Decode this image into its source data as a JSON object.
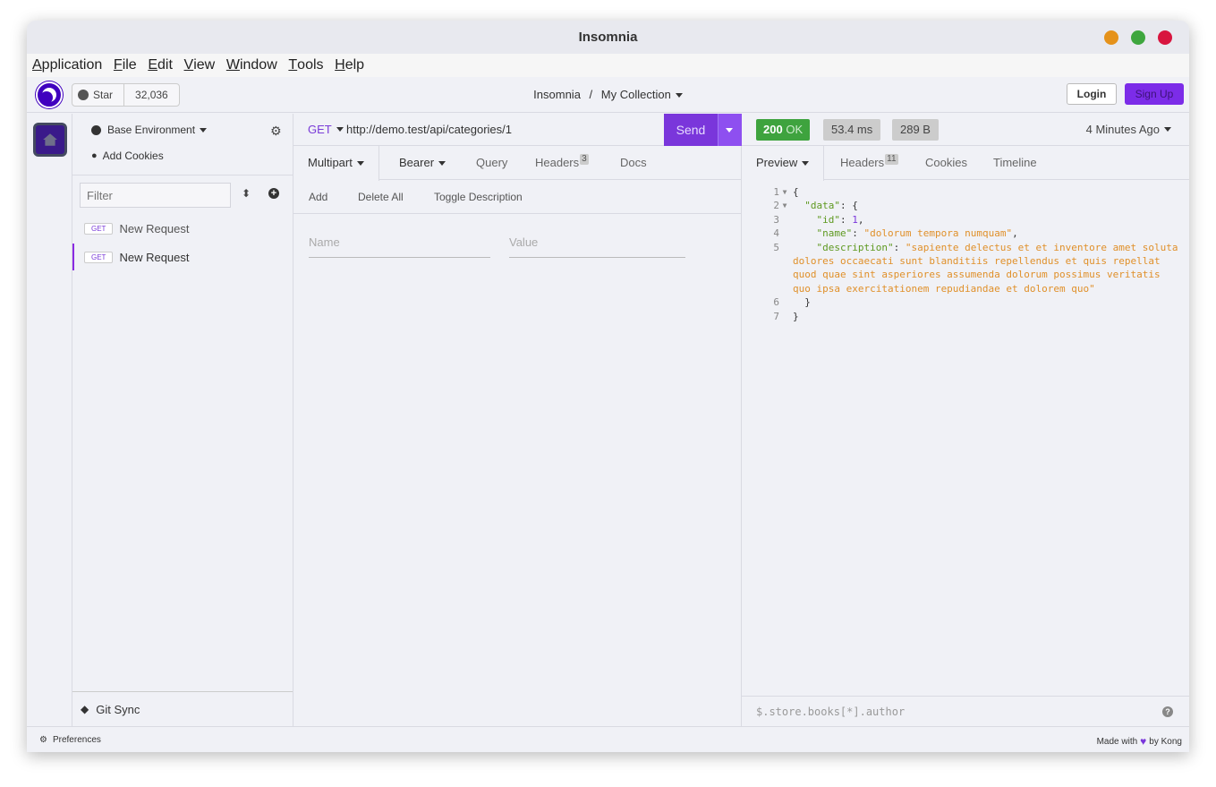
{
  "window": {
    "title": "Insomnia"
  },
  "menu": [
    {
      "label": "Application",
      "key": "A",
      "rest": "pplication"
    },
    {
      "label": "File",
      "key": "F",
      "rest": "ile"
    },
    {
      "label": "Edit",
      "key": "E",
      "rest": "dit"
    },
    {
      "label": "View",
      "key": "V",
      "rest": "iew"
    },
    {
      "label": "Window",
      "key": "W",
      "rest": "indow"
    },
    {
      "label": "Tools",
      "key": "T",
      "rest": "ools"
    },
    {
      "label": "Help",
      "key": "H",
      "rest": "elp"
    }
  ],
  "header": {
    "star_label": "Star",
    "star_count": "32,036",
    "crumb_root": "Insomnia",
    "crumb_sep": "/",
    "crumb_collection": "My Collection",
    "login": "Login",
    "signup": "Sign Up"
  },
  "sidebar": {
    "environment": "Base Environment",
    "add_cookies": "Add Cookies",
    "filter_placeholder": "Filter",
    "requests": [
      {
        "method": "GET",
        "name": "New Request"
      },
      {
        "method": "GET",
        "name": "New Request"
      }
    ],
    "git_sync": "Git Sync"
  },
  "request": {
    "method": "GET",
    "url": "http://demo.test/api/categories/1",
    "send": "Send",
    "tabs": {
      "body": "Multipart",
      "auth": "Bearer",
      "query": "Query",
      "headers": "Headers",
      "headers_count": "3",
      "docs": "Docs"
    },
    "actions": {
      "add": "Add",
      "delete_all": "Delete All",
      "toggle_desc": "Toggle Description"
    },
    "name_placeholder": "Name",
    "value_placeholder": "Value"
  },
  "response": {
    "status_code": "200",
    "status_text": "OK",
    "time": "53.4 ms",
    "size": "289 B",
    "ago": "4 Minutes Ago",
    "tabs": {
      "preview": "Preview",
      "headers": "Headers",
      "headers_count": "11",
      "cookies": "Cookies",
      "timeline": "Timeline"
    },
    "body": {
      "id_value": "1",
      "name_value": "\"dolorum tempora numquam\"",
      "description_value": "\"sapiente delectus et et inventore amet soluta dolores occaecati sunt blanditiis repellendus et quis repellat quod quae sint asperiores assumenda dolorum possimus veritatis quo ipsa exercitationem repudiandae et dolorem quo\""
    },
    "filter_placeholder": "$.store.books[*].author"
  },
  "footer": {
    "preferences": "Preferences",
    "made_with": "Made with",
    "by_kong": "by Kong"
  },
  "colors": {
    "accent": "#7a36db",
    "status_ok": "#3ea33e"
  }
}
